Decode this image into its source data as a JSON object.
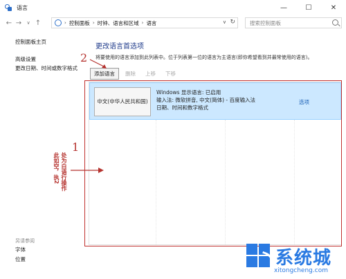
{
  "window": {
    "title": "语言",
    "min_icon": "minimize-icon",
    "max_icon": "maximize-icon",
    "close_icon": "close-icon"
  },
  "address": {
    "crumbs": [
      "控制面板",
      "时钟、语言和区域",
      "语言"
    ],
    "search_placeholder": "搜索控制面板"
  },
  "sidebar": {
    "home": "控制面板主页",
    "advanced": "高级设置",
    "change_date": "更改日期、时间或数字格式",
    "see_also_header": "另请参阅",
    "see_also": [
      "字体",
      "位置"
    ]
  },
  "main": {
    "title": "更改语言首选项",
    "description": "将要使用的语言添加到此列表中。位于列表第一位的语言为主语言(即你希望看到并最常使用的语言)。",
    "toolbar": {
      "add": "添加语言",
      "remove": "删除",
      "up": "上移",
      "down": "下移"
    },
    "languages": [
      {
        "name": "中文(中华人民共和国)",
        "details": [
          "Windows 显示语言: 已启用",
          "输入法: 微软拼音, 中文(简体) - 百度输入法",
          "日期、时间和数字格式"
        ],
        "options": "选项"
      }
    ]
  },
  "annotations": {
    "step1": "1",
    "step2": "2",
    "step1_col1": "处为白语行操作",
    "step1_col2": "此如空，执2"
  },
  "watermark": {
    "brand": "系统城",
    "url": "xitongcheng.com"
  },
  "colors": {
    "accent": "#1a5fb4",
    "annotation": "#b5322e",
    "selection": "#cce8ff"
  }
}
